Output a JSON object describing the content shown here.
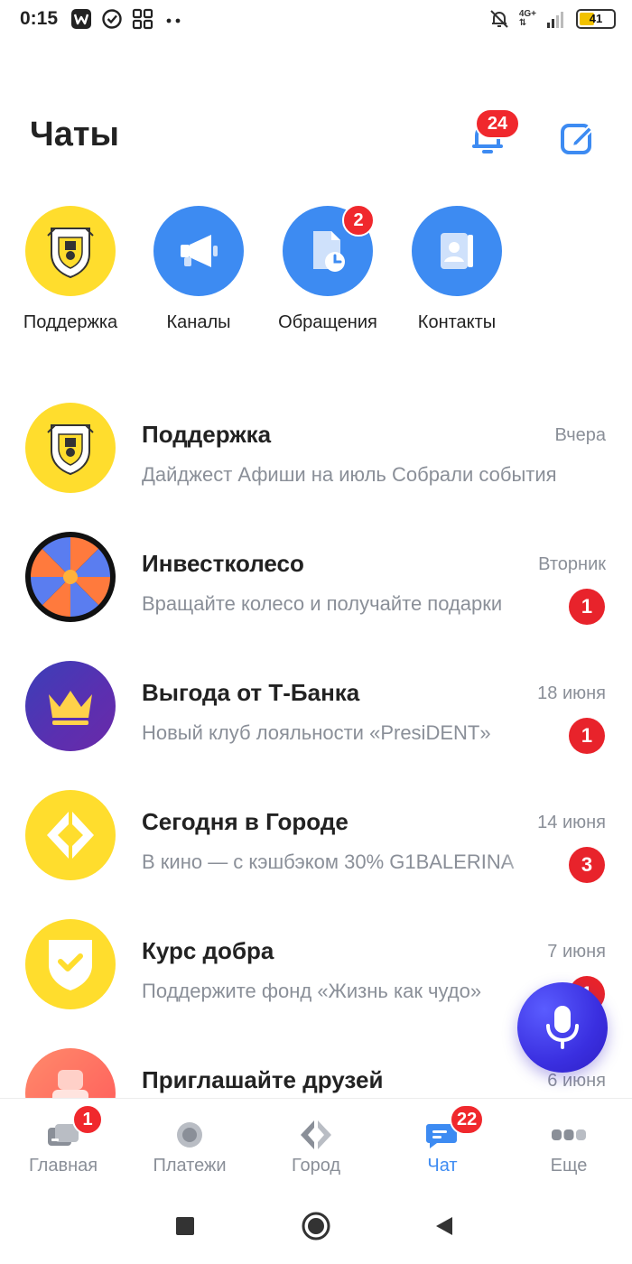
{
  "status_bar": {
    "time": "0:15",
    "network": "4G+",
    "battery": "41",
    "battery_color": "#f2c200"
  },
  "header": {
    "title": "Чаты",
    "notifications_count": "24"
  },
  "quick_actions": [
    {
      "label": "Поддержка",
      "icon": "tinkoff-logo-icon"
    },
    {
      "label": "Каналы",
      "icon": "megaphone-icon"
    },
    {
      "label": "Обращения",
      "icon": "document-clock-icon",
      "badge": "2"
    },
    {
      "label": "Контакты",
      "icon": "contacts-book-icon"
    }
  ],
  "chats": [
    {
      "title": "Поддержка",
      "date": "Вчера",
      "preview": "Дайджест Афиши на июль Собрали события",
      "unread": ""
    },
    {
      "title": "Инвестколесо",
      "date": "Вторник",
      "preview": "Вращайте колесо и получайте подарки",
      "unread": "1"
    },
    {
      "title": "Выгода от Т-Банка",
      "date": "18 июня",
      "preview": "Новый клуб лояльности «PresiDENT»",
      "unread": "1"
    },
    {
      "title": "Сегодня в Городе",
      "date": "14 июня",
      "preview": "В кино — с кэшбэком 30% G1BALERINA",
      "unread": "3"
    },
    {
      "title": "Курс добра",
      "date": "7 июня",
      "preview": "Поддержите фонд «Жизнь как чудо»",
      "unread": "1"
    },
    {
      "title": "Приглашайте друзей",
      "date": "6 июня",
      "preview": "",
      "unread": ""
    }
  ],
  "bottom_nav": [
    {
      "label": "Главная",
      "icon": "home-card-icon",
      "badge": "1"
    },
    {
      "label": "Платежи",
      "icon": "payments-circle-icon",
      "badge": ""
    },
    {
      "label": "Город",
      "icon": "city-diamond-icon",
      "badge": ""
    },
    {
      "label": "Чат",
      "icon": "chat-bubble-icon",
      "badge": "22",
      "active": true
    },
    {
      "label": "Еще",
      "icon": "more-dots-icon",
      "badge": ""
    }
  ],
  "colors": {
    "accent": "#3d8bf2",
    "badge": "#f0282d",
    "brand_yellow": "#ffdd2d",
    "secondary_text": "#8a8f98"
  }
}
